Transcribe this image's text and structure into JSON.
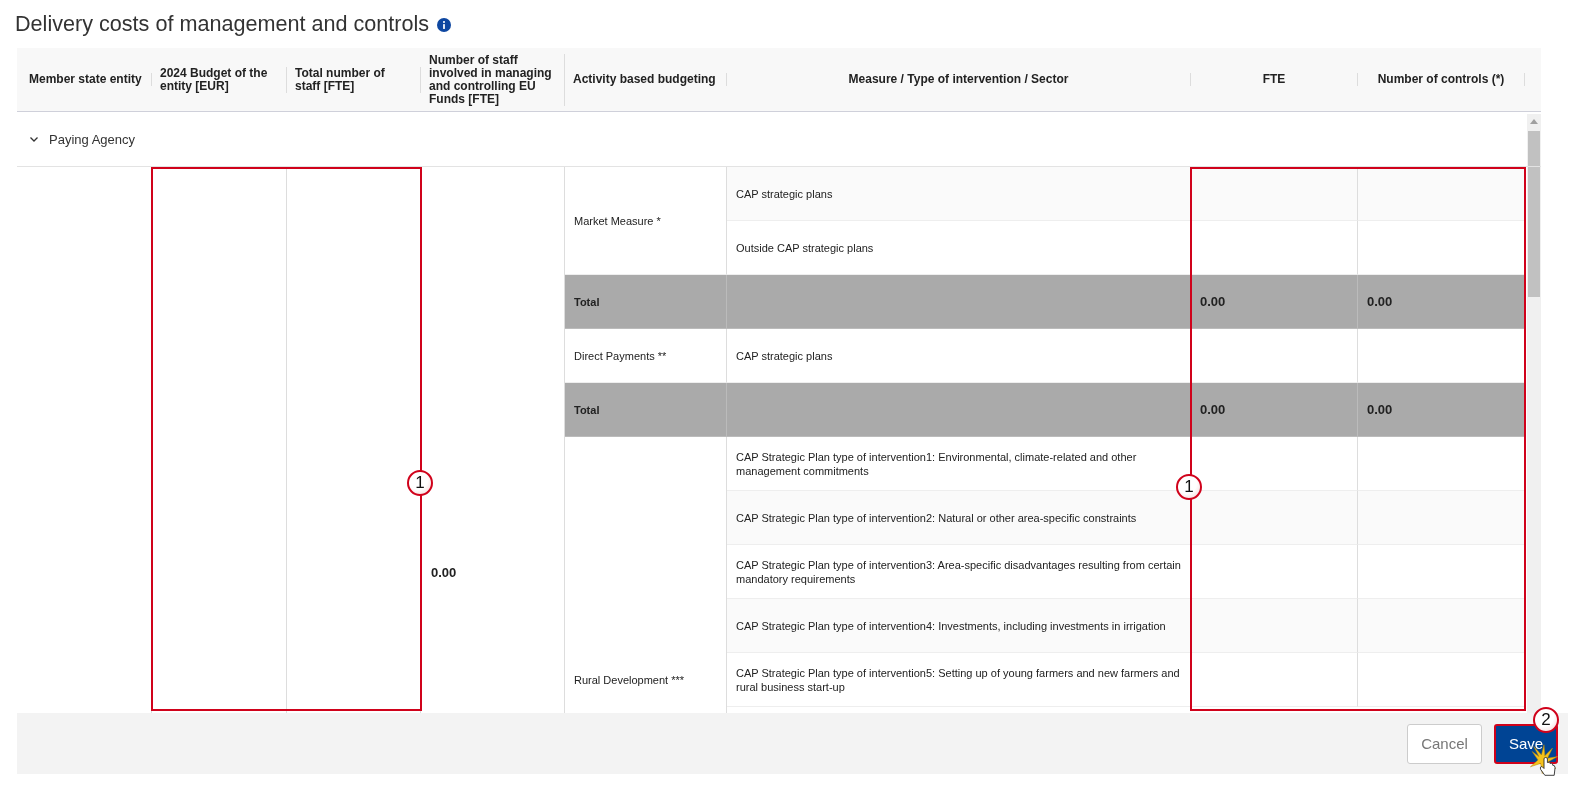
{
  "title": "Delivery costs of management and controls",
  "columns": [
    "Member state entity",
    "2024 Budget of the entity [EUR]",
    "Total number of staff [FTE]",
    "Number of staff involved in managing and controlling EU Funds [FTE]",
    "Activity based budgeting",
    "Measure / Type of intervention / Sector",
    "FTE",
    "Number of controls (*)"
  ],
  "group": {
    "label": "Paying Agency",
    "expanded": true
  },
  "staff_value": "0.00",
  "activities": [
    {
      "label": "Market Measure *",
      "measures": [
        "CAP strategic plans",
        "Outside CAP strategic plans"
      ],
      "total": {
        "label": "Total",
        "fte": "0.00",
        "controls": "0.00"
      }
    },
    {
      "label": "Direct Payments **",
      "measures": [
        "CAP strategic plans"
      ],
      "total": {
        "label": "Total",
        "fte": "0.00",
        "controls": "0.00"
      }
    },
    {
      "label": "Rural Development ***",
      "measures": [
        "CAP Strategic Plan type of intervention1: Environmental, climate-related and other management commitments",
        "CAP Strategic Plan type of intervention2: Natural or other area-specific constraints",
        "CAP Strategic Plan type of intervention3: Area-specific disadvantages resulting from certain mandatory requirements",
        "CAP Strategic Plan type of intervention4: Investments, including investments in irrigation",
        "CAP Strategic Plan type of intervention5: Setting up of young farmers and new farmers and rural business start-up"
      ]
    }
  ],
  "annotations": [
    {
      "number": "1"
    },
    {
      "number": "1"
    },
    {
      "number": "2"
    }
  ],
  "buttons": [
    {
      "label": "Cancel",
      "kind": "secondary"
    },
    {
      "label": "Save",
      "kind": "primary"
    }
  ]
}
